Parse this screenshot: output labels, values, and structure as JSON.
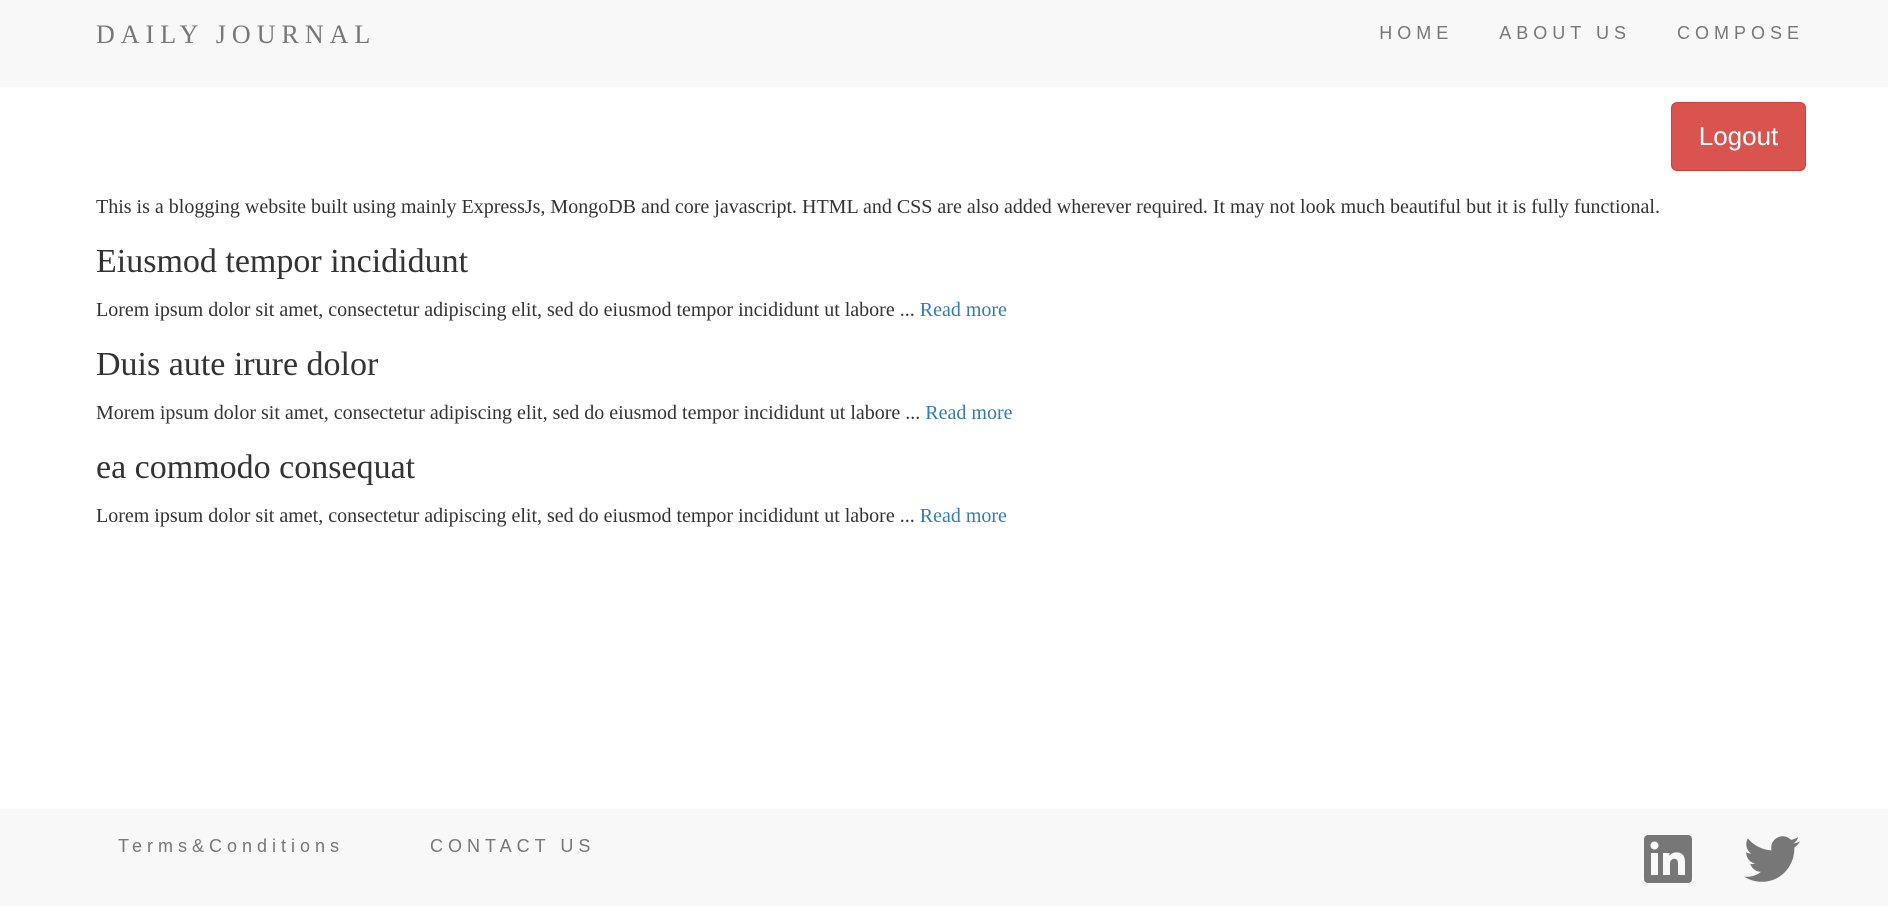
{
  "header": {
    "brand": "DAILY JOURNAL",
    "nav": [
      {
        "label": "HOME"
      },
      {
        "label": "ABOUT US"
      },
      {
        "label": "COMPOSE"
      }
    ]
  },
  "logout_label": "Logout",
  "intro": "This is a blogging website built using mainly ExpressJs, MongoDB and core javascript. HTML and CSS are also added wherever required. It may not look much beautiful but it is fully functional.",
  "posts": [
    {
      "title": "Eiusmod tempor incididunt",
      "excerpt": "Lorem ipsum dolor sit amet, consectetur adipiscing elit, sed do eiusmod tempor incididunt ut labore ... ",
      "link": "Read more"
    },
    {
      "title": "Duis aute irure dolor",
      "excerpt": "Morem ipsum dolor sit amet, consectetur adipiscing elit, sed do eiusmod tempor incididunt ut labore ... ",
      "link": "Read more"
    },
    {
      "title": "ea commodo consequat",
      "excerpt": "Lorem ipsum dolor sit amet, consectetur adipiscing elit, sed do eiusmod tempor incididunt ut labore ... ",
      "link": "Read more"
    }
  ],
  "footer": {
    "terms": "Terms&Conditions",
    "contact": "CONTACT US",
    "icons": [
      "linkedin-icon",
      "twitter-icon"
    ]
  },
  "colors": {
    "nav_bg": "#f8f8f8",
    "nav_text": "#777777",
    "logout_bg": "#d9534f",
    "link": "#337ab7",
    "body_text": "#333333"
  }
}
